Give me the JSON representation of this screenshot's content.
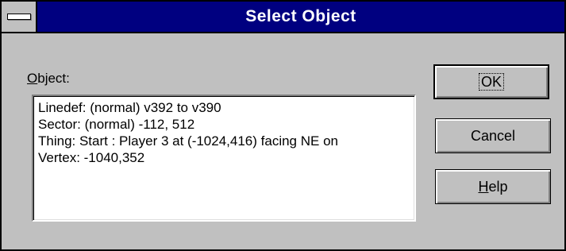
{
  "window": {
    "title": "Select Object"
  },
  "object_label": {
    "mnemonic": "O",
    "rest": "bject:"
  },
  "objects": [
    "Linedef: (normal) v392 to v390",
    "Sector: (normal) -112, 512",
    "Thing: Start : Player 3 at (-1024,416) facing NE on",
    "Vertex: -1040,352"
  ],
  "buttons": {
    "ok": "OK",
    "cancel": "Cancel",
    "help_mnemonic": "H",
    "help_rest": "elp"
  }
}
